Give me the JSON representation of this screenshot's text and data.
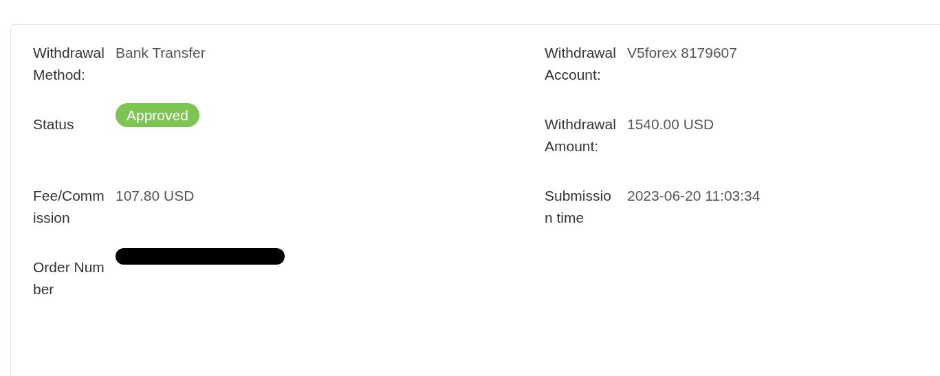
{
  "fields": [
    {
      "label": "Withdrawal Method:",
      "kind": "text",
      "value": "Bank Transfer"
    },
    {
      "label": "Withdrawal Account:",
      "kind": "text",
      "value": "V5forex 8179607"
    },
    {
      "label": "Status",
      "kind": "badge",
      "value": "Approved"
    },
    {
      "label": "Withdrawal Amount:",
      "kind": "text",
      "value": "1540.00 USD"
    },
    {
      "label": "Fee/Commission",
      "kind": "text",
      "value": "107.80 USD"
    },
    {
      "label": "Submission time",
      "kind": "text",
      "value": "2023-06-20 11:03:34"
    },
    {
      "label": "Order Number",
      "kind": "redacted"
    }
  ]
}
